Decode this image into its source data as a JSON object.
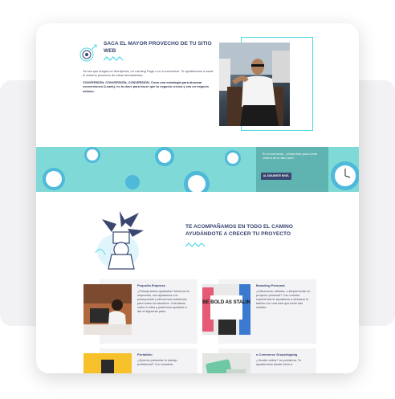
{
  "hero": {
    "title": "SACA EL MAYOR PROVECHO DE TU SITIO WEB",
    "paragraph": "Ya sea que tengas un Wordpress, un Landing Page o un e-commerce. Te ayudaremos a sacar el máximo provecho de estas herramientas.",
    "paragraph2": "CONVERSIÓN, CONVERSIÓN, CONVERSIÓN. Crear una estrategia para alcanzar conversiones (Leads), es la clave para hacer que tu negocio crezca y sea un negocio exitoso."
  },
  "banner": {
    "text": "En el momento, ¿Estás listo para tomar control de tu sitio web?",
    "button_label": "AL SIGUIENTE NIVEL"
  },
  "section2": {
    "title": "TE ACOMPAÑAMOS EN TODO EL CAMINO AYUDÁNDOTE A CRECER TU PROYECTO"
  },
  "services": [
    {
      "title": "Pequeña Empresa",
      "text": "¿Presupuestos ajustados? tenemos la respuesta, nos ajustamos a tu presupuesto y ofrecemos soluciones para todos los tamaños. Cuéntanos sobre tu idea y podremos ayudarte a dar el siguiente paso."
    },
    {
      "title": "Branding Personal",
      "text": "¿Influencers, artistas, o simplemente un proyecto personal? Con nuestra experiencia te ayudamos a destacar tu talento con una web que tanto has soñado."
    },
    {
      "title": "Portafolio",
      "text": "¿Quieres presentar tu trabajo profesional? Con nuestras"
    },
    {
      "title": "e-Commerce Dropshipping",
      "text": "¿Vender online? no problema. Te ayudaremos desde inicio a"
    }
  ],
  "poster_text": "BE BOLD AS STALIN",
  "colors": {
    "accent": "#4fd8e5",
    "navy": "#3a4670",
    "teal": "#7fd9d6"
  }
}
